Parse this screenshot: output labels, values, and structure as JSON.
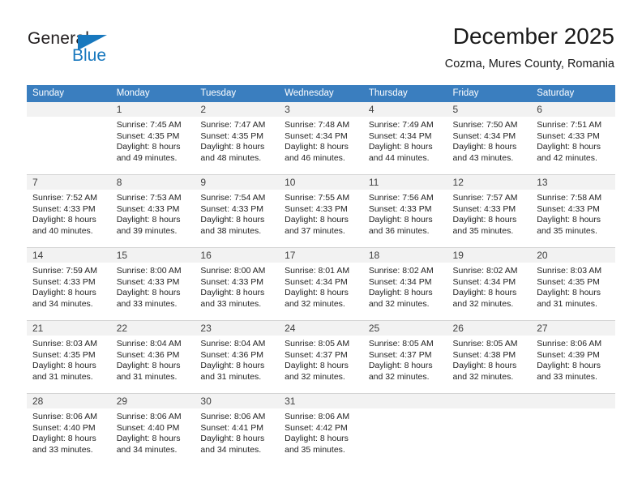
{
  "brand": {
    "name_part1": "General",
    "name_part2": "Blue"
  },
  "header": {
    "title": "December 2025",
    "subtitle": "Cozma, Mures County, Romania"
  },
  "colors": {
    "header_blue": "#3a7ebf",
    "logo_blue": "#1878be",
    "daynum_bg": "#f2f2f2",
    "grid_line": "#d4d4d4"
  },
  "weekdays": [
    "Sunday",
    "Monday",
    "Tuesday",
    "Wednesday",
    "Thursday",
    "Friday",
    "Saturday"
  ],
  "weeks": [
    [
      {
        "day": "",
        "empty": true,
        "sunrise": "",
        "sunset": "",
        "daylight_line1": "",
        "daylight_line2": ""
      },
      {
        "day": "1",
        "sunrise": "Sunrise: 7:45 AM",
        "sunset": "Sunset: 4:35 PM",
        "daylight_line1": "Daylight: 8 hours",
        "daylight_line2": "and 49 minutes."
      },
      {
        "day": "2",
        "sunrise": "Sunrise: 7:47 AM",
        "sunset": "Sunset: 4:35 PM",
        "daylight_line1": "Daylight: 8 hours",
        "daylight_line2": "and 48 minutes."
      },
      {
        "day": "3",
        "sunrise": "Sunrise: 7:48 AM",
        "sunset": "Sunset: 4:34 PM",
        "daylight_line1": "Daylight: 8 hours",
        "daylight_line2": "and 46 minutes."
      },
      {
        "day": "4",
        "sunrise": "Sunrise: 7:49 AM",
        "sunset": "Sunset: 4:34 PM",
        "daylight_line1": "Daylight: 8 hours",
        "daylight_line2": "and 44 minutes."
      },
      {
        "day": "5",
        "sunrise": "Sunrise: 7:50 AM",
        "sunset": "Sunset: 4:34 PM",
        "daylight_line1": "Daylight: 8 hours",
        "daylight_line2": "and 43 minutes."
      },
      {
        "day": "6",
        "sunrise": "Sunrise: 7:51 AM",
        "sunset": "Sunset: 4:33 PM",
        "daylight_line1": "Daylight: 8 hours",
        "daylight_line2": "and 42 minutes."
      }
    ],
    [
      {
        "day": "7",
        "sunrise": "Sunrise: 7:52 AM",
        "sunset": "Sunset: 4:33 PM",
        "daylight_line1": "Daylight: 8 hours",
        "daylight_line2": "and 40 minutes."
      },
      {
        "day": "8",
        "sunrise": "Sunrise: 7:53 AM",
        "sunset": "Sunset: 4:33 PM",
        "daylight_line1": "Daylight: 8 hours",
        "daylight_line2": "and 39 minutes."
      },
      {
        "day": "9",
        "sunrise": "Sunrise: 7:54 AM",
        "sunset": "Sunset: 4:33 PM",
        "daylight_line1": "Daylight: 8 hours",
        "daylight_line2": "and 38 minutes."
      },
      {
        "day": "10",
        "sunrise": "Sunrise: 7:55 AM",
        "sunset": "Sunset: 4:33 PM",
        "daylight_line1": "Daylight: 8 hours",
        "daylight_line2": "and 37 minutes."
      },
      {
        "day": "11",
        "sunrise": "Sunrise: 7:56 AM",
        "sunset": "Sunset: 4:33 PM",
        "daylight_line1": "Daylight: 8 hours",
        "daylight_line2": "and 36 minutes."
      },
      {
        "day": "12",
        "sunrise": "Sunrise: 7:57 AM",
        "sunset": "Sunset: 4:33 PM",
        "daylight_line1": "Daylight: 8 hours",
        "daylight_line2": "and 35 minutes."
      },
      {
        "day": "13",
        "sunrise": "Sunrise: 7:58 AM",
        "sunset": "Sunset: 4:33 PM",
        "daylight_line1": "Daylight: 8 hours",
        "daylight_line2": "and 35 minutes."
      }
    ],
    [
      {
        "day": "14",
        "sunrise": "Sunrise: 7:59 AM",
        "sunset": "Sunset: 4:33 PM",
        "daylight_line1": "Daylight: 8 hours",
        "daylight_line2": "and 34 minutes."
      },
      {
        "day": "15",
        "sunrise": "Sunrise: 8:00 AM",
        "sunset": "Sunset: 4:33 PM",
        "daylight_line1": "Daylight: 8 hours",
        "daylight_line2": "and 33 minutes."
      },
      {
        "day": "16",
        "sunrise": "Sunrise: 8:00 AM",
        "sunset": "Sunset: 4:33 PM",
        "daylight_line1": "Daylight: 8 hours",
        "daylight_line2": "and 33 minutes."
      },
      {
        "day": "17",
        "sunrise": "Sunrise: 8:01 AM",
        "sunset": "Sunset: 4:34 PM",
        "daylight_line1": "Daylight: 8 hours",
        "daylight_line2": "and 32 minutes."
      },
      {
        "day": "18",
        "sunrise": "Sunrise: 8:02 AM",
        "sunset": "Sunset: 4:34 PM",
        "daylight_line1": "Daylight: 8 hours",
        "daylight_line2": "and 32 minutes."
      },
      {
        "day": "19",
        "sunrise": "Sunrise: 8:02 AM",
        "sunset": "Sunset: 4:34 PM",
        "daylight_line1": "Daylight: 8 hours",
        "daylight_line2": "and 32 minutes."
      },
      {
        "day": "20",
        "sunrise": "Sunrise: 8:03 AM",
        "sunset": "Sunset: 4:35 PM",
        "daylight_line1": "Daylight: 8 hours",
        "daylight_line2": "and 31 minutes."
      }
    ],
    [
      {
        "day": "21",
        "sunrise": "Sunrise: 8:03 AM",
        "sunset": "Sunset: 4:35 PM",
        "daylight_line1": "Daylight: 8 hours",
        "daylight_line2": "and 31 minutes."
      },
      {
        "day": "22",
        "sunrise": "Sunrise: 8:04 AM",
        "sunset": "Sunset: 4:36 PM",
        "daylight_line1": "Daylight: 8 hours",
        "daylight_line2": "and 31 minutes."
      },
      {
        "day": "23",
        "sunrise": "Sunrise: 8:04 AM",
        "sunset": "Sunset: 4:36 PM",
        "daylight_line1": "Daylight: 8 hours",
        "daylight_line2": "and 31 minutes."
      },
      {
        "day": "24",
        "sunrise": "Sunrise: 8:05 AM",
        "sunset": "Sunset: 4:37 PM",
        "daylight_line1": "Daylight: 8 hours",
        "daylight_line2": "and 32 minutes."
      },
      {
        "day": "25",
        "sunrise": "Sunrise: 8:05 AM",
        "sunset": "Sunset: 4:37 PM",
        "daylight_line1": "Daylight: 8 hours",
        "daylight_line2": "and 32 minutes."
      },
      {
        "day": "26",
        "sunrise": "Sunrise: 8:05 AM",
        "sunset": "Sunset: 4:38 PM",
        "daylight_line1": "Daylight: 8 hours",
        "daylight_line2": "and 32 minutes."
      },
      {
        "day": "27",
        "sunrise": "Sunrise: 8:06 AM",
        "sunset": "Sunset: 4:39 PM",
        "daylight_line1": "Daylight: 8 hours",
        "daylight_line2": "and 33 minutes."
      }
    ],
    [
      {
        "day": "28",
        "sunrise": "Sunrise: 8:06 AM",
        "sunset": "Sunset: 4:40 PM",
        "daylight_line1": "Daylight: 8 hours",
        "daylight_line2": "and 33 minutes."
      },
      {
        "day": "29",
        "sunrise": "Sunrise: 8:06 AM",
        "sunset": "Sunset: 4:40 PM",
        "daylight_line1": "Daylight: 8 hours",
        "daylight_line2": "and 34 minutes."
      },
      {
        "day": "30",
        "sunrise": "Sunrise: 8:06 AM",
        "sunset": "Sunset: 4:41 PM",
        "daylight_line1": "Daylight: 8 hours",
        "daylight_line2": "and 34 minutes."
      },
      {
        "day": "31",
        "sunrise": "Sunrise: 8:06 AM",
        "sunset": "Sunset: 4:42 PM",
        "daylight_line1": "Daylight: 8 hours",
        "daylight_line2": "and 35 minutes."
      },
      {
        "day": "",
        "empty": true,
        "sunrise": "",
        "sunset": "",
        "daylight_line1": "",
        "daylight_line2": ""
      },
      {
        "day": "",
        "empty": true,
        "sunrise": "",
        "sunset": "",
        "daylight_line1": "",
        "daylight_line2": ""
      },
      {
        "day": "",
        "empty": true,
        "sunrise": "",
        "sunset": "",
        "daylight_line1": "",
        "daylight_line2": ""
      }
    ]
  ]
}
